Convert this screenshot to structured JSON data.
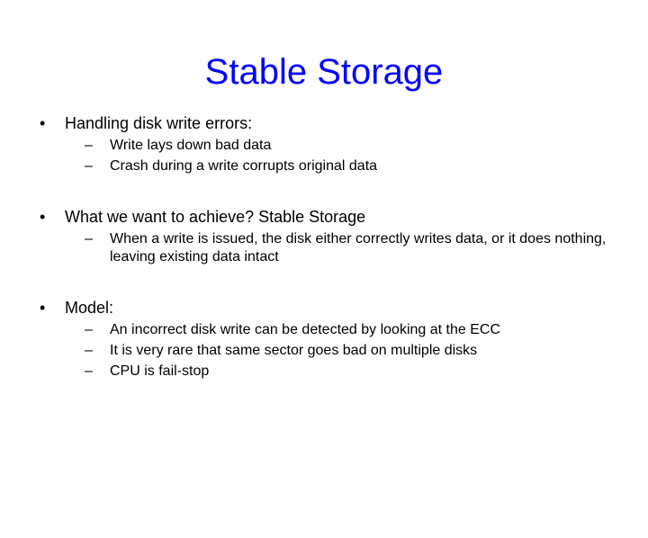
{
  "title": "Stable Storage",
  "b1": {
    "heading": "Handling disk write errors:",
    "s1": "Write lays down bad data",
    "s2": "Crash during a write corrupts original data"
  },
  "b2": {
    "heading": "What we want to achieve? Stable Storage",
    "s1": "When a write is issued, the disk either correctly writes data, or it does nothing, leaving existing data intact"
  },
  "b3": {
    "heading": "Model:",
    "s1": "An incorrect disk write can be detected by looking at the ECC",
    "s2": "It is very rare that same sector goes bad on multiple disks",
    "s3": "CPU is fail-stop"
  }
}
